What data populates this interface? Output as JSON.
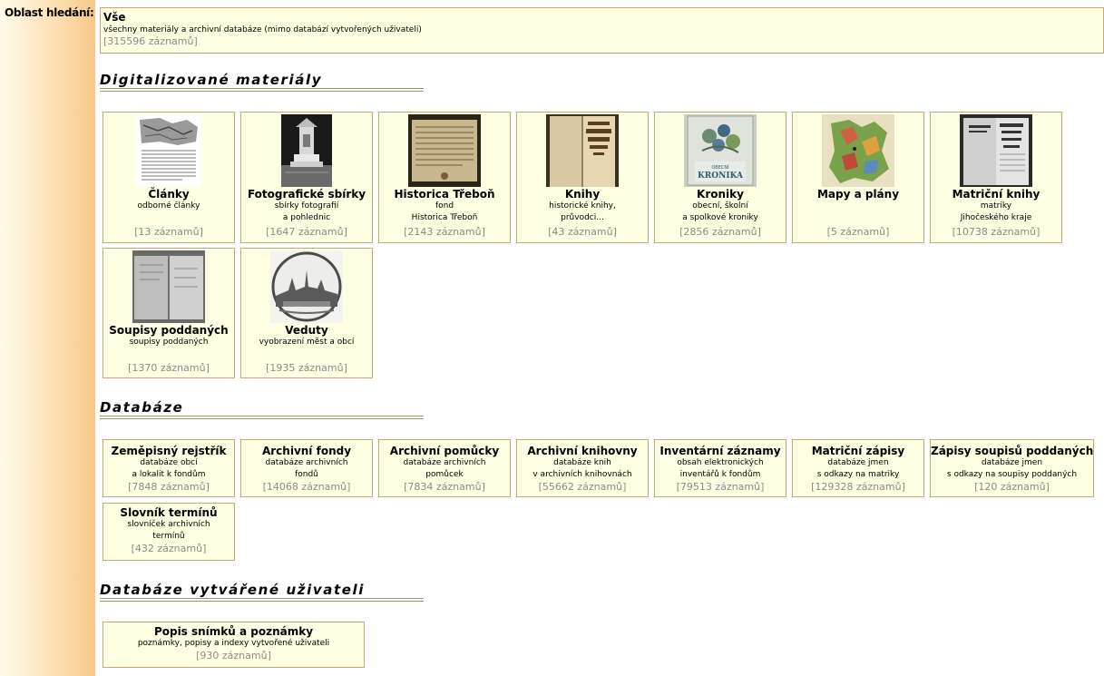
{
  "sidebar": {
    "label": "Oblast hledání:"
  },
  "all": {
    "title": "Vše",
    "desc": "všechny materiály a archivní databáze (mimo databází vytvořených uživateli)",
    "count": "[315596 záznamů]"
  },
  "digital": {
    "title": "Digitalizované materiály",
    "items": [
      {
        "title": "Články",
        "desc": "odborné články",
        "count": "[13 záznamů]",
        "icon": "articles-thumbnail"
      },
      {
        "title": "Fotografické sbírky",
        "desc": "sbírky fotografií\na pohlednic",
        "count": "[1647 záznamů]",
        "icon": "photo-collection-thumbnail"
      },
      {
        "title": "Historica Třeboň",
        "desc": "fond\nHistorica Třeboň",
        "count": "[2143 záznamů]",
        "icon": "historica-document-thumbnail"
      },
      {
        "title": "Knihy",
        "desc": "historické knihy,\nprůvodci...",
        "count": "[43 záznamů]",
        "icon": "book-thumbnail"
      },
      {
        "title": "Kroniky",
        "desc": "obecní, školní\na spolkové kroniky",
        "count": "[2856 záznamů]",
        "icon": "chronicle-thumbnail",
        "cover_text": "OBECNÍ\nKRONIKA"
      },
      {
        "title": "Mapy a plány",
        "desc": "",
        "count": "[5 záznamů]",
        "icon": "map-thumbnail"
      },
      {
        "title": "Matriční knihy",
        "desc": "matriky\nJihočeského kraje",
        "count": "[10738 záznamů]",
        "icon": "register-book-thumbnail"
      },
      {
        "title": "Soupisy poddaných",
        "desc": "soupisy poddaných",
        "count": "[1370 záznamů]",
        "icon": "census-book-thumbnail"
      },
      {
        "title": "Veduty",
        "desc": "vyobrazení měst a obcí",
        "count": "[1935 záznamů]",
        "icon": "veduta-thumbnail"
      }
    ]
  },
  "databases": {
    "title": "Databáze",
    "items": [
      {
        "title": "Zeměpisný rejstřík",
        "desc": "databáze obcí\na lokalit k fondům",
        "count": "[7848 záznamů]"
      },
      {
        "title": "Archivní fondy",
        "desc": "databáze archivních\nfondů",
        "count": "[14068 záznamů]"
      },
      {
        "title": "Archivní pomůcky",
        "desc": "databáze archivních\npomůcek",
        "count": "[7834 záznamů]"
      },
      {
        "title": "Archivní knihovny",
        "desc": "databáze knih\nv archivních knihovnách",
        "count": "[55662 záznamů]"
      },
      {
        "title": "Inventární záznamy",
        "desc": "obsah elektronických\ninventářů k fondům",
        "count": "[79513 záznamů]"
      },
      {
        "title": "Matriční zápisy",
        "desc": "databáze jmen\ns odkazy na matriky",
        "count": "[129328 záznamů]"
      },
      {
        "title": "Zápisy soupisů poddaných",
        "desc": "databáze jmen\ns odkazy na soupisy poddaných",
        "count": "[120 záznamů]"
      },
      {
        "title": "Slovník termínů",
        "desc": "slovníček archivních\ntermínů",
        "count": "[432 záznamů]"
      }
    ]
  },
  "user_db": {
    "title": "Databáze vytvářené uživateli",
    "items": [
      {
        "title": "Popis snímků a poznámky",
        "desc": "poznámky, popisy a indexy vytvořené uživateli",
        "count": "[930 záznamů]"
      }
    ]
  },
  "colors": {
    "card_bg": "#ffffe3",
    "card_border": "#c8a877",
    "count_text": "#8a8a8a",
    "sidebar_accent": "#f7c98a"
  }
}
